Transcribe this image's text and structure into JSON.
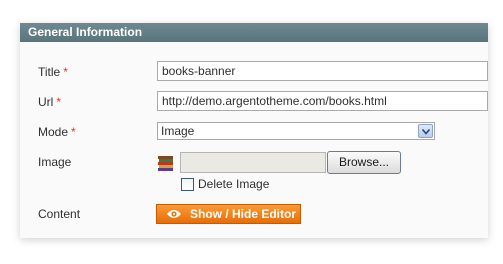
{
  "panel": {
    "title": "General Information"
  },
  "fields": {
    "title": {
      "label": "Title",
      "required_mark": "*",
      "value": "books-banner"
    },
    "url": {
      "label": "Url",
      "required_mark": "*",
      "value": "http://demo.argentotheme.com/books.html"
    },
    "mode": {
      "label": "Mode",
      "required_mark": "*",
      "selected": "Image"
    },
    "image": {
      "label": "Image",
      "browse_label": "Browse...",
      "delete_label": "Delete Image",
      "delete_checked": false,
      "thumbnail_icon": "book-stack-icon"
    },
    "content": {
      "label": "Content",
      "editor_button_label": "Show / Hide Editor",
      "editor_icon": "eye-icon"
    }
  },
  "colors": {
    "header_bg": "#647e87",
    "required": "#eb340a",
    "button_orange": "#f28a1d"
  }
}
